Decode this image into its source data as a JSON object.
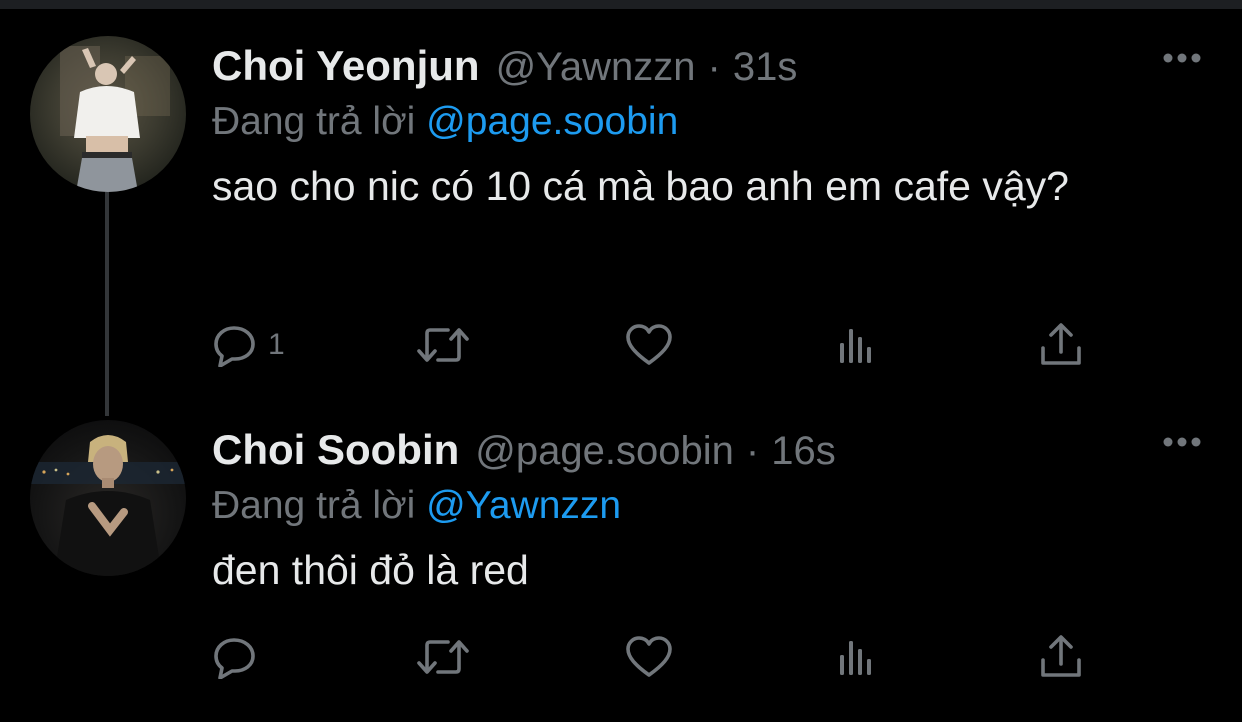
{
  "tweets": [
    {
      "name": "Choi Yeonjun",
      "handle": "@Yawnzzn",
      "dot": "·",
      "time": "31s",
      "reply_prefix": "Đang trả lời",
      "reply_to": "@page.soobin",
      "text": "sao cho nic có 10 cá mà bao anh em cafe vậy?",
      "reply_count": "1"
    },
    {
      "name": "Choi Soobin",
      "handle": "@page.soobin",
      "dot": "·",
      "time": "16s",
      "reply_prefix": "Đang trả lời",
      "reply_to": "@Yawnzzn",
      "text": "đen thôi đỏ là red",
      "reply_count": ""
    }
  ],
  "icons": {
    "more": "more-horizontal-icon",
    "reply": "reply-bubble-icon",
    "retweet": "retweet-icon",
    "like": "heart-icon",
    "stats": "analytics-icon",
    "share": "share-upload-icon"
  },
  "colors": {
    "background": "#000000",
    "primary_text": "#e7e9ea",
    "secondary_text": "#71767b",
    "mention": "#1d9bf0",
    "thread_line": "#333639"
  }
}
